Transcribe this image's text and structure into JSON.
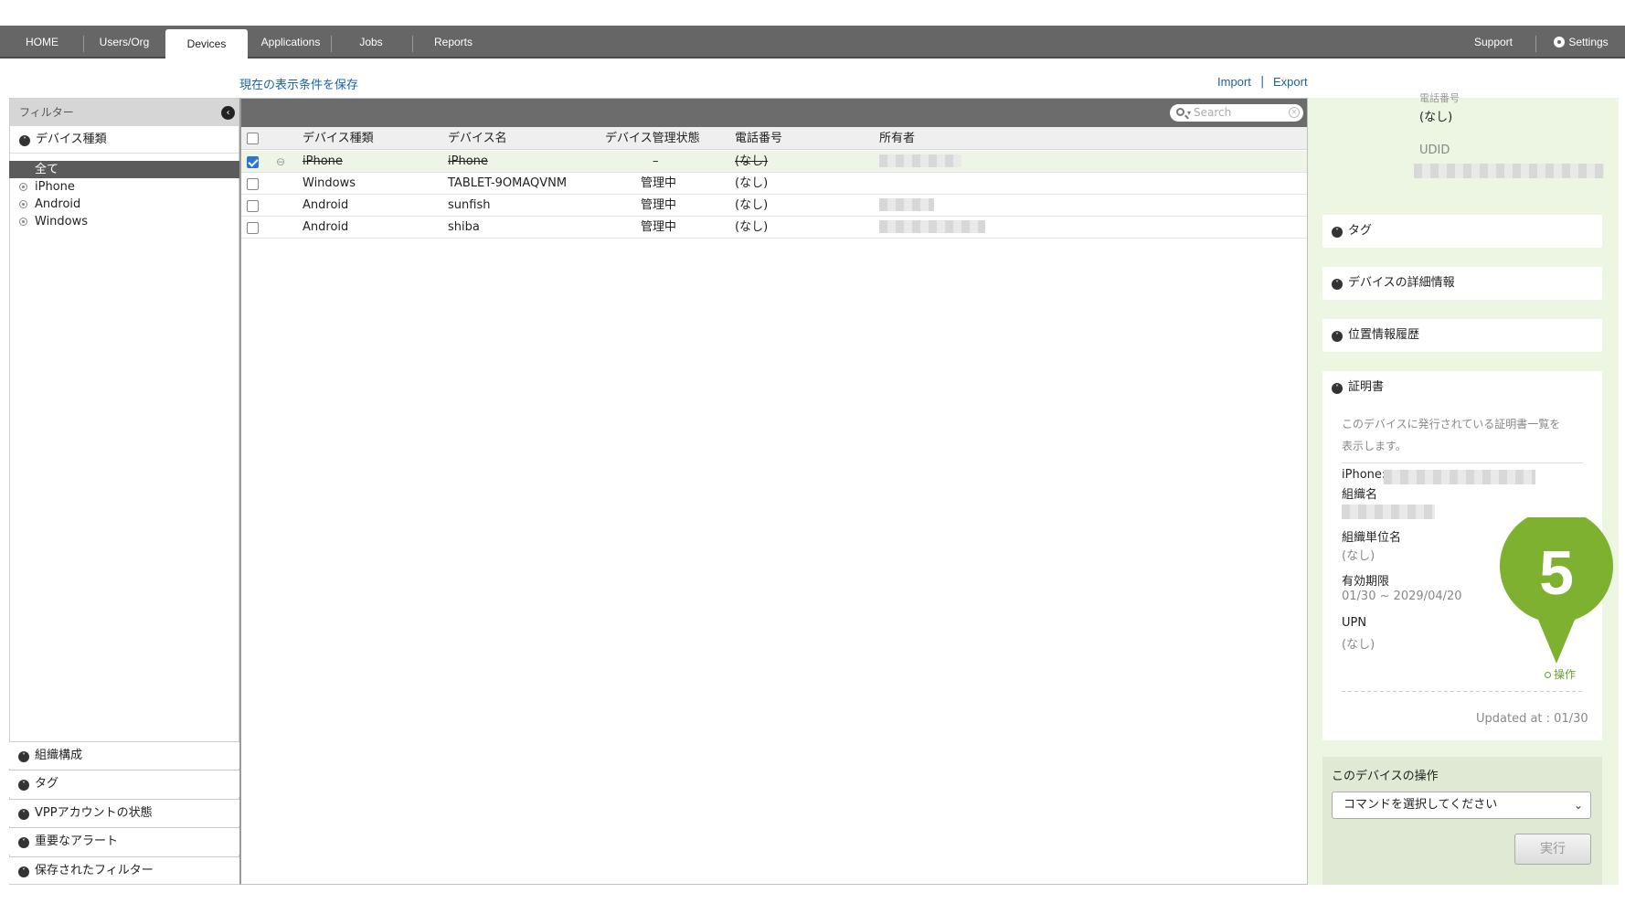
{
  "nav": {
    "tabs": [
      {
        "label": "HOME"
      },
      {
        "label": "Users/Org"
      },
      {
        "label": "Devices"
      },
      {
        "label": "Applications"
      },
      {
        "label": "Jobs"
      },
      {
        "label": "Reports"
      }
    ],
    "active_tab": "Devices",
    "support": "Support",
    "settings": "Settings"
  },
  "links": {
    "save_conditions": "現在の表示条件を保存",
    "import": "Import",
    "separator": "|",
    "export": "Export"
  },
  "filter": {
    "title": "フィルター",
    "device_type_section": "デバイス種類",
    "device_types": [
      {
        "label": "全て",
        "selected": true
      },
      {
        "label": "iPhone",
        "selected": false
      },
      {
        "label": "Android",
        "selected": false
      },
      {
        "label": "Windows",
        "selected": false
      }
    ],
    "bottom_sections": [
      {
        "label": "組織構成"
      },
      {
        "label": "タグ"
      },
      {
        "label": "VPPアカウントの状態"
      },
      {
        "label": "重要なアラート"
      },
      {
        "label": "保存されたフィルター"
      }
    ]
  },
  "table": {
    "search_placeholder": "Search",
    "columns": [
      "デバイス種類",
      "デバイス名",
      "デバイス管理状態",
      "電話番号",
      "所有者"
    ],
    "rows": [
      {
        "type": "iPhone",
        "name": "iPhone",
        "status": "–",
        "phone": "(なし)",
        "checked": true,
        "strikethrough": true
      },
      {
        "type": "Windows",
        "name": "TABLET-9OMAQVNM",
        "status": "管理中",
        "phone": "(なし)",
        "checked": false,
        "strikethrough": false
      },
      {
        "type": "Android",
        "name": "sunfish",
        "status": "管理中",
        "phone": "(なし)",
        "checked": false,
        "strikethrough": false
      },
      {
        "type": "Android",
        "name": "shiba",
        "status": "管理中",
        "phone": "(なし)",
        "checked": false,
        "strikethrough": false
      }
    ]
  },
  "detail": {
    "phone_label": "電話番号",
    "phone_value": "(なし)",
    "udid_label": "UDID",
    "sections": [
      {
        "label": "タグ"
      },
      {
        "label": "デバイスの詳細情報"
      },
      {
        "label": "位置情報履歴"
      }
    ],
    "certificate": {
      "title": "証明書",
      "description_line1": "このデバイスに発行されている証明書一覧を",
      "description_line2": "表示します。",
      "device_label": "iPhone:",
      "org_label": "組織名",
      "unit_label": "組織単位名",
      "unit_value": "(なし)",
      "expiry_label": "有効期限",
      "expiry_value": "01/30 ~ 2029/04/20",
      "upn_label": "UPN",
      "upn_value": "(なし)",
      "operation_link": "操作",
      "updated_at": "Updated at : 01/30"
    },
    "operations": {
      "title": "このデバイスの操作",
      "select_placeholder": "コマンドを選択してください",
      "execute_button": "実行"
    }
  },
  "callout": {
    "number": "5",
    "color": "#7fb131"
  }
}
